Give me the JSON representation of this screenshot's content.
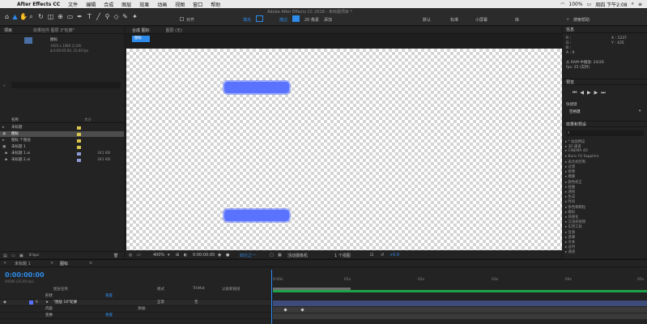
{
  "menubar": {
    "app": "After Effects CC",
    "items": [
      "文件",
      "编辑",
      "合成",
      "图层",
      "效果",
      "动画",
      "视图",
      "窗口",
      "帮助"
    ],
    "battery": "100%",
    "clock": "周四 下午2:08"
  },
  "toolbar": {
    "window_title": "Adobe After Effects CC 2018 - 未标题项目 *",
    "align_label": "对齐",
    "fill_label": "填充",
    "stroke_label": "描边",
    "stroke_px": "20 像素",
    "add_label": "添加",
    "workspaces": [
      "默认",
      "标准",
      "小屏幕",
      "库"
    ],
    "search_placeholder": "搜索帮助"
  },
  "project": {
    "header": "项目",
    "effect_controls_tab": "效果控件 图层 3\"轮廓\"",
    "selected_name": "图标",
    "selected_info1": "1920 x 1080 (1.00)",
    "selected_info2": "Δ 0:00:05:00, 25.00 fps",
    "col_name": "名称",
    "col_size": "大小",
    "rows": [
      {
        "name": "未标题",
        "size": ""
      },
      {
        "name": "图标",
        "size": ""
      },
      {
        "name": "图标 个图层",
        "size": ""
      },
      {
        "name": "未标题 1",
        "size": ""
      },
      {
        "name": "未标题 1.ai",
        "size": "341 KB"
      },
      {
        "name": "未标题 2.ai",
        "size": "341 KB"
      }
    ],
    "bpc": "8 bpc"
  },
  "viewer": {
    "tab_comp": "合成 图标",
    "tab_layer": "图层 (无)",
    "breadcrumb": "图标",
    "zoom": "400%",
    "timecode": "0:00:00:00",
    "resolution": "四分之一",
    "camera": "活动摄像机",
    "views": "1 个视图",
    "exposure": "+0.0"
  },
  "right": {
    "info_header": "信息",
    "info_r": "R :",
    "info_g": "G :",
    "info_b": "B :",
    "info_a": "A : 0",
    "info_x": "X : 1237",
    "info_y": "Y : 435",
    "ram_line1": "从 RAM 中播放: 24/26",
    "ram_line2": "fps: 25 (实时)",
    "preview_header": "预览",
    "shortcut_label": "快捷键",
    "shortcut_value": "空格键",
    "fx_header": "效果和预设",
    "fx_items": [
      "* 动画预设",
      "3D 通道",
      "CINEMA 4D",
      "Boris FX Sapphire",
      "表达式控制",
      "过渡",
      "抠像",
      "模糊",
      "颜色校正",
      "扭曲",
      "透视",
      "生成",
      "时间",
      "杂色和颗粒",
      "模拟",
      "风格化",
      "沉浸式视频",
      "实用工具",
      "音频",
      "遮罩",
      "文本",
      "过时",
      "通道"
    ]
  },
  "timeline": {
    "tab_comp1": "未标题 1",
    "tab_comp2": "图标",
    "timecode": "0:00:00:00",
    "fps": "00000 (25.00 fps)",
    "col_source": "图层名称",
    "col_mode": "模式",
    "col_trk": "TrkMat",
    "col_parent": "父级和链接",
    "ruler": [
      "0:00s",
      "01s",
      "02s",
      "03s",
      "04s",
      "05s"
    ],
    "layers": [
      {
        "num": "",
        "name": "形状",
        "mode": "",
        "parent": ""
      },
      {
        "num": "6",
        "name": "\"图层 10\"轮廓",
        "mode": "正常",
        "parent": "无"
      },
      {
        "num": "",
        "name": "内容",
        "mode": "",
        "parent": "添加:"
      },
      {
        "num": "",
        "name": "变换",
        "mode": "",
        "parent": "重置"
      }
    ],
    "link_blue": "重置"
  },
  "colors": {
    "accent": "#2d8ceb",
    "pill": "#5a73ff",
    "work_bar": "#1fa34a"
  }
}
